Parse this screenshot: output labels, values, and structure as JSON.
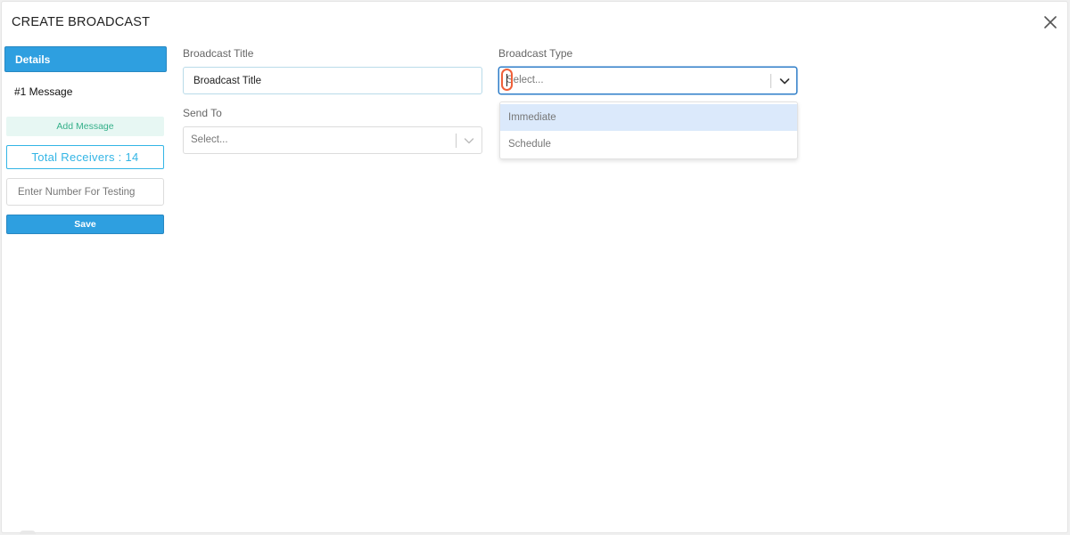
{
  "modal": {
    "title": "CREATE BROADCAST"
  },
  "sidebar": {
    "tabs": [
      {
        "label": "Details",
        "active": true
      },
      {
        "label": "#1 Message",
        "active": false
      }
    ],
    "add_message_label": "Add Message",
    "total_receivers_label": "Total Receivers : 14",
    "test_number_placeholder": "Enter Number For Testing",
    "save_label": "Save"
  },
  "form": {
    "broadcast_title": {
      "label": "Broadcast Title",
      "value": "Broadcast Title"
    },
    "broadcast_type": {
      "label": "Broadcast Type",
      "placeholder": "Select...",
      "options": [
        "Immediate",
        "Schedule"
      ],
      "highlighted_option": "Immediate"
    },
    "send_to": {
      "label": "Send To",
      "placeholder": "Select..."
    }
  },
  "colors": {
    "primary": "#2e9fe0",
    "accent_green": "#35b08a",
    "receivers_blue": "#33b5e5",
    "focus_border": "#2e7dc8",
    "option_highlight": "#dbe9fb",
    "cursor_ring": "#f0603a"
  },
  "icons": {
    "close": "close-icon",
    "chevron": "chevron-down-icon"
  }
}
